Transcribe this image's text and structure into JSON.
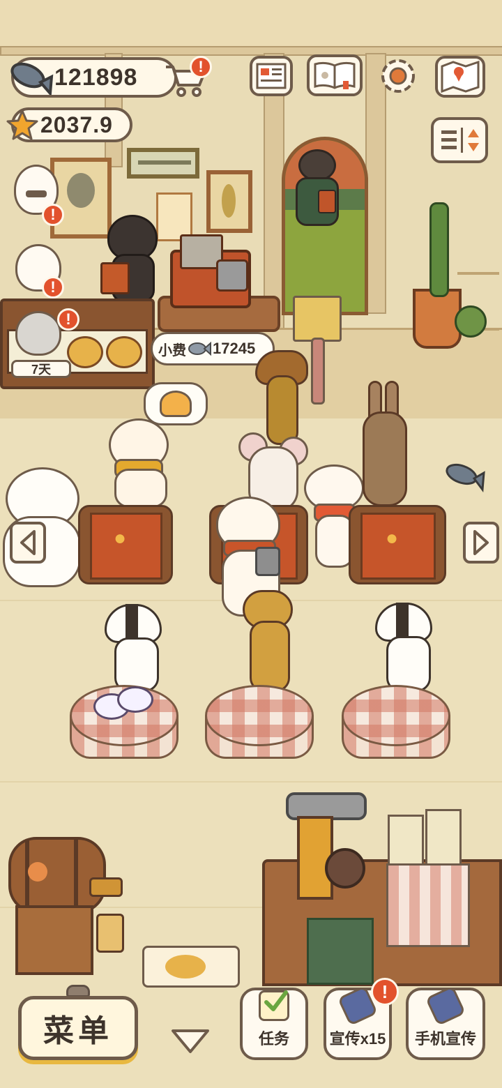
{
  "hud": {
    "fish_amount": "121898",
    "star_amount": "2037.9",
    "alert_mark": "!"
  },
  "counter": {
    "days_badge": "7天"
  },
  "tip_bubble": {
    "label": "小费",
    "amount": "17245"
  },
  "bottom_bar": {
    "menu_label": "菜单",
    "tasks_label": "任务",
    "promote_label": "宣传x15",
    "phone_promote_label": "手机宣传"
  },
  "icons": {
    "fish": "fish-icon",
    "star": "star-icon",
    "cart": "shop-cart-icon",
    "newspaper": "newspaper-icon",
    "pawbook": "paw-book-icon",
    "settings": "gear-icon",
    "map": "map-icon",
    "sort": "sort-toggle-icon"
  },
  "colors": {
    "outline": "#6e5b4a",
    "alert": "#e2522d",
    "menu_shadow": "#e8b840",
    "background": "#efe3bd"
  }
}
